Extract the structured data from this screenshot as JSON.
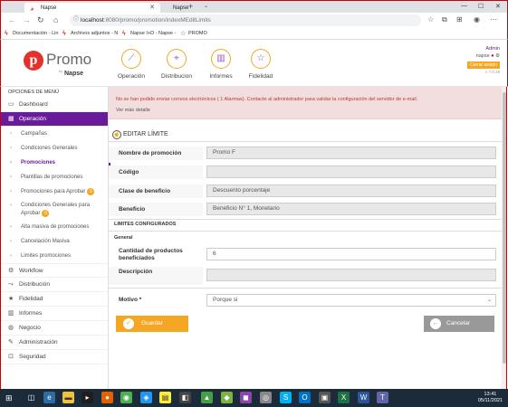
{
  "browser": {
    "tabs": [
      {
        "label": "Napse",
        "active": true
      },
      {
        "label": "Napse",
        "active": false
      }
    ],
    "url_host": "localhost",
    "url_path": ":8080/promo/promotion/indexMEditLimits",
    "bookmarks": [
      {
        "label": "Documentación - Lin",
        "icon": "lightning-icon"
      },
      {
        "label": "Archivos adjuntos - N",
        "icon": "lightning-icon"
      },
      {
        "label": "Napse I+D - Napse -",
        "icon": "lightning-icon"
      },
      {
        "label": "PROMO",
        "icon": "star-icon"
      }
    ]
  },
  "header": {
    "logo_text": "Promo",
    "logo_by": "by",
    "logo_sub": "Napse",
    "modules": [
      {
        "label": "Operación",
        "icon": "chart-icon"
      },
      {
        "label": "Distribucion",
        "icon": "map-pin-icon"
      },
      {
        "label": "Informes",
        "icon": "bar-chart-icon"
      },
      {
        "label": "Fidelidad",
        "icon": "star-icon"
      }
    ],
    "user_role": "Admin",
    "user_name": "napse",
    "logout_label": "Cerrar sesión",
    "version": "v 7.0.19"
  },
  "sidebar": {
    "title": "OPCIONES DE MENÚ",
    "dashboard": "Dashboard",
    "operacion": "Operación",
    "sub_items": [
      {
        "label": "Campañas",
        "badge": ""
      },
      {
        "label": "Condiciones Generales",
        "badge": ""
      },
      {
        "label": "Promociones",
        "badge": "",
        "active": true
      },
      {
        "label": "Plantillas de promociones",
        "badge": ""
      },
      {
        "label": "Promociones para Aprobar",
        "badge": "0"
      },
      {
        "label": "Condiciones Generales para Aprobar",
        "badge": "0"
      },
      {
        "label": "Alta masiva de promociones",
        "badge": ""
      },
      {
        "label": "Cancelación Masiva",
        "badge": ""
      },
      {
        "label": "Limites promociones",
        "badge": ""
      }
    ],
    "bottom_items": [
      {
        "label": "Workflow",
        "icon": "gear-icon"
      },
      {
        "label": "Distribución",
        "icon": "share-icon"
      },
      {
        "label": "Fidelidad",
        "icon": "star-icon"
      },
      {
        "label": "Informes",
        "icon": "bar-chart-icon"
      },
      {
        "label": "Negocio",
        "icon": "globe-icon"
      },
      {
        "label": "Administración",
        "icon": "wrench-icon"
      },
      {
        "label": "Seguridad",
        "icon": "lock-icon"
      }
    ]
  },
  "alert": {
    "message": "No se han podido enviar correos electrónicos ( 1 Alarmas). Contacte al administrador para validar la configuración del servidor de e-mail.",
    "more_label": "Ver más detalle"
  },
  "form": {
    "title": "EDITAR LÍMITE",
    "nombre_label": "Nombre de promoción",
    "nombre_value": "Promo F",
    "codigo_label": "Código",
    "codigo_value": "",
    "clase_label": "Clase de beneficio",
    "clase_value": "Descuento porcentaje",
    "beneficio_label": "Beneficio",
    "beneficio_value": "Beneficio N° 1, Monetario",
    "limites_header": "LIMITES CONFIGURADOS",
    "general_label": "General",
    "cantidad_label": "Cantidad de productos beneficiados",
    "cantidad_value": "6",
    "descripcion_label": "Descripción",
    "descripcion_value": "",
    "motivo_label": "Motivo *",
    "motivo_value": "Porque si",
    "save_label": "Guardar",
    "cancel_label": "Cancelar"
  },
  "taskbar": {
    "time": "13:41",
    "date": "05/11/2021"
  },
  "colors": {
    "brand_purple": "#6a1b9a",
    "accent_orange": "#f5a623",
    "alert_bg": "#f2dede",
    "alert_text": "#c0392b"
  }
}
